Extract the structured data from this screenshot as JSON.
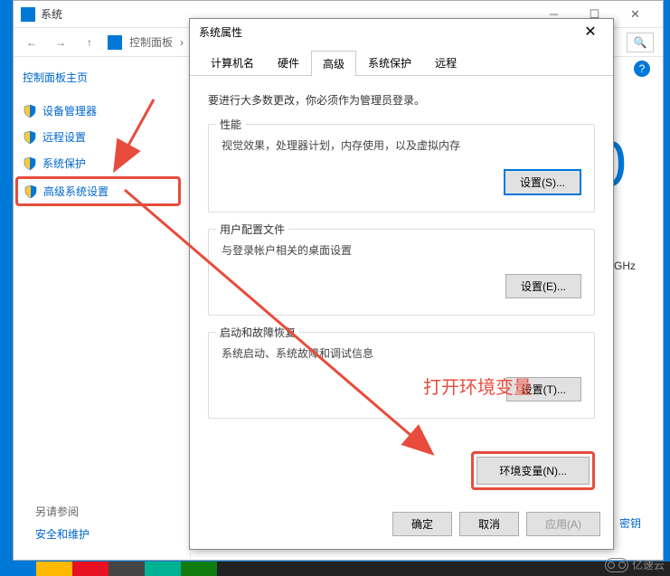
{
  "cp": {
    "title": "系统",
    "breadcrumb": "控制面板",
    "sidebar_home": "控制面板主页",
    "items": [
      {
        "label": "设备管理器"
      },
      {
        "label": "远程设置"
      },
      {
        "label": "系统保护"
      },
      {
        "label": "高级系统设置"
      }
    ],
    "zero": "0",
    "ghz": "0 GHz",
    "footer_label": "另请参阅",
    "footer_link": "安全和维护",
    "key_link": "密钥"
  },
  "sp": {
    "title": "系统属性",
    "tabs": [
      "计算机名",
      "硬件",
      "高级",
      "系统保护",
      "远程"
    ],
    "note": "要进行大多数更改，你必须作为管理员登录。",
    "groups": [
      {
        "title": "性能",
        "desc": "视觉效果，处理器计划，内存使用，以及虚拟内存",
        "btn": "设置(S)..."
      },
      {
        "title": "用户配置文件",
        "desc": "与登录帐户相关的桌面设置",
        "btn": "设置(E)..."
      },
      {
        "title": "启动和故障恢复",
        "desc": "系统启动、系统故障和调试信息",
        "btn": "设置(T)..."
      }
    ],
    "env_btn": "环境变量(N)...",
    "ok": "确定",
    "cancel": "取消",
    "apply": "应用(A)"
  },
  "anno": {
    "text": "打开环境变量"
  },
  "watermark": "亿速云"
}
